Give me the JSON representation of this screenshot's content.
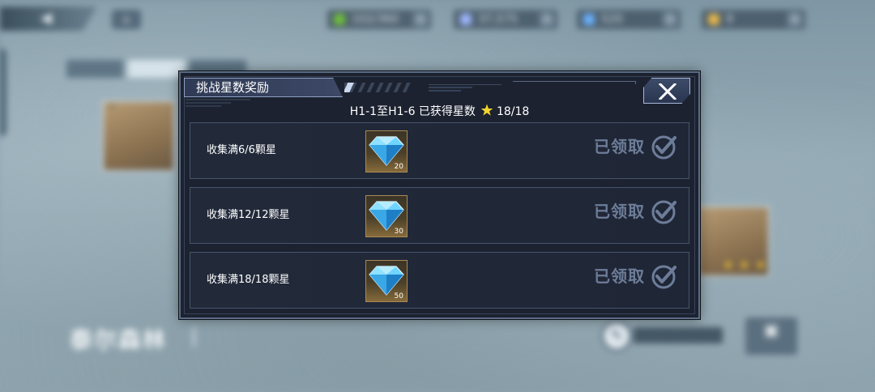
{
  "background": {
    "resources": [
      {
        "icon": "gold-icon",
        "value": "102/360",
        "color": "#6fbf3a"
      },
      {
        "icon": "diamond-icon",
        "value": "37,575",
        "color": "#9fb8ff"
      },
      {
        "icon": "ticket-icon",
        "value": "520",
        "color": "#6bb2ff"
      },
      {
        "icon": "coin-icon",
        "value": "9",
        "color": "#e8b84a"
      }
    ],
    "region_name": "泰尔森林"
  },
  "dialog": {
    "title": "挑战星数奖励",
    "summary_text": "H1-1至H1-6 已获得星数",
    "star_count": "18/18",
    "close_icon": "close-icon",
    "rows": [
      {
        "label": "收集满6/6颗星",
        "reward_icon": "diamond-icon",
        "reward_qty": "20",
        "status": "已领取"
      },
      {
        "label": "收集满12/12颗星",
        "reward_icon": "diamond-icon",
        "reward_qty": "30",
        "status": "已领取"
      },
      {
        "label": "收集满18/18颗星",
        "reward_icon": "diamond-icon",
        "reward_qty": "50",
        "status": "已领取"
      }
    ]
  },
  "colors": {
    "dialog_bg": "#1c2230",
    "dialog_border": "#5b6c86",
    "star": "#f2d42e",
    "claimed_stamp": "#6d7d99"
  }
}
